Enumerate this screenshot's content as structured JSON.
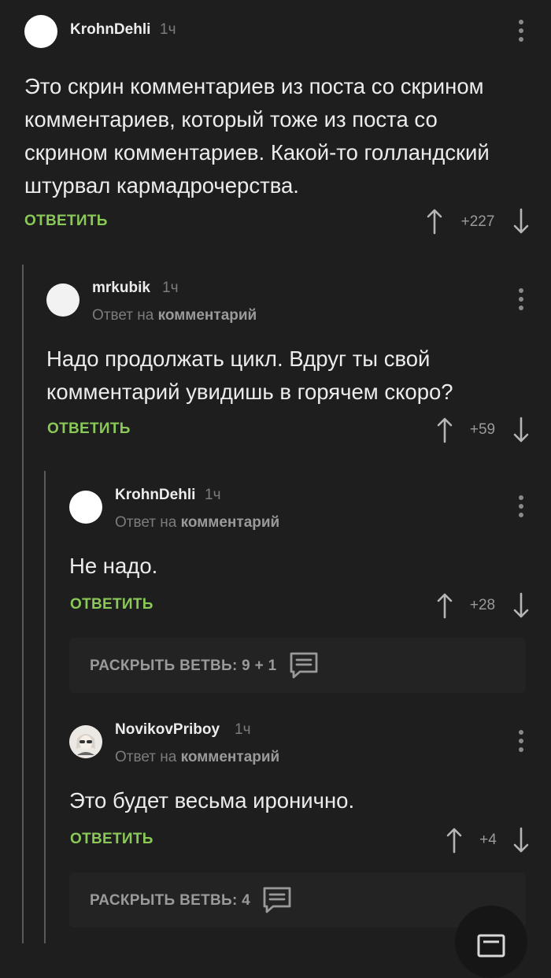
{
  "comments": [
    {
      "author": "KrohnDehli",
      "time": "1ч",
      "text_lines": [
        "Это скрин комментариев из поста со скрином",
        "комментариев, который тоже из поста со",
        "скрином комментариев. Какой-то голландский",
        "штурвал кармадрочерства."
      ],
      "reply_label": "ОТВЕТИТЬ",
      "score": "+227"
    },
    {
      "author": "mrkubik",
      "time": "1ч",
      "reply_to_prefix": "Ответ на",
      "reply_to_link": "комментарий",
      "text_lines": [
        "Надо продолжать цикл. Вдруг ты свой",
        "комментарий увидишь в горячем скоро?"
      ],
      "reply_label": "ОТВЕТИТЬ",
      "score": "+59"
    },
    {
      "author": "KrohnDehli",
      "time": "1ч",
      "reply_to_prefix": "Ответ на",
      "reply_to_link": "комментарий",
      "text_lines": [
        "Не надо."
      ],
      "reply_label": "ОТВЕТИТЬ",
      "score": "+28"
    },
    {
      "author": "NovikovPriboy",
      "time": "1ч",
      "reply_to_prefix": "Ответ на",
      "reply_to_link": "комментарий",
      "text_lines": [
        "Это будет весьма иронично."
      ],
      "reply_label": "ОТВЕТИТЬ",
      "score": "+4"
    }
  ],
  "expanders": [
    {
      "label": "РАСКРЫТЬ ВЕТВЬ: 9 + 1",
      "icon": "comment-icon"
    },
    {
      "label": "РАСКРЫТЬ ВЕТВЬ: 4",
      "icon": "comment-icon"
    }
  ],
  "colors": {
    "background": "#1e1e1e",
    "accent": "#8ac858",
    "muted": "#7c7c7c"
  }
}
